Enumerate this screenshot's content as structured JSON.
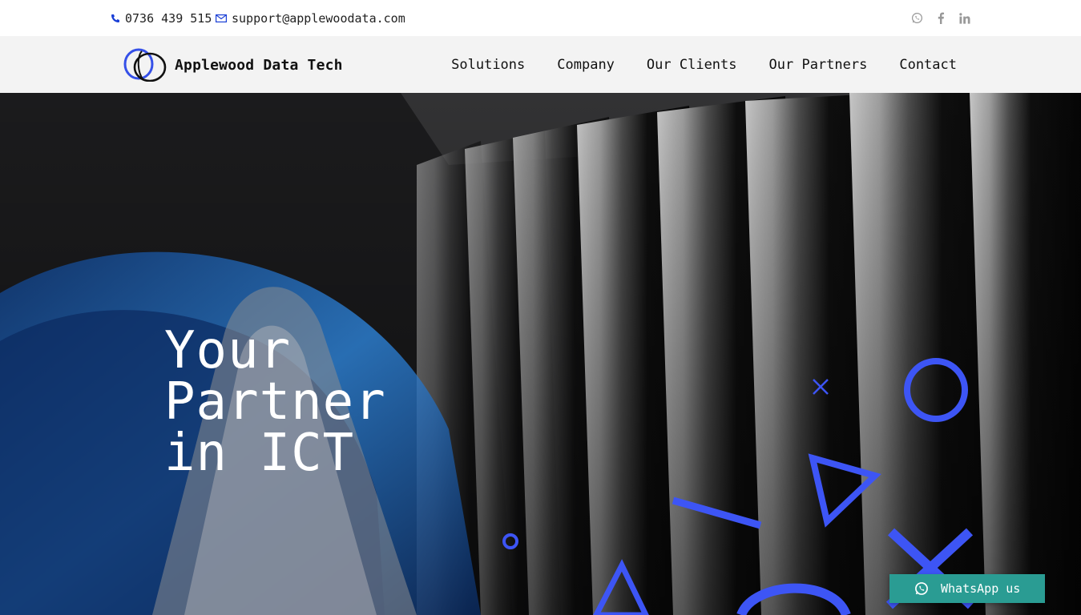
{
  "topbar": {
    "phone": "0736 439 515",
    "email": "support@applewoodata.com",
    "social": [
      "whatsapp-icon",
      "facebook-icon",
      "linkedin-icon"
    ]
  },
  "brand": {
    "name": "Applewood Data Tech"
  },
  "nav": {
    "items": [
      {
        "label": "Solutions"
      },
      {
        "label": "Company"
      },
      {
        "label": "Our Clients"
      },
      {
        "label": "Our Partners"
      },
      {
        "label": "Contact"
      }
    ]
  },
  "hero": {
    "title_lines": [
      "Your",
      "Partner",
      "in ICT"
    ]
  },
  "whatsapp": {
    "label": "WhatsApp us"
  },
  "colors": {
    "accent": "#3d55f5",
    "whatsapp": "#2a9c93",
    "phone_icon": "#1a3fd6"
  }
}
